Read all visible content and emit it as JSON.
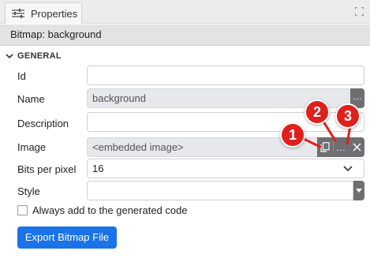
{
  "panel": {
    "tab_label": "Properties"
  },
  "header": {
    "title": "Bitmap: background"
  },
  "section": {
    "title": "GENERAL"
  },
  "fields": {
    "id": {
      "label": "Id",
      "value": ""
    },
    "name": {
      "label": "Name",
      "value": "background"
    },
    "description": {
      "label": "Description",
      "value": ""
    },
    "image": {
      "label": "Image",
      "value": "<embedded image>"
    },
    "bits_per_pixel": {
      "label": "Bits per pixel",
      "value": "16"
    },
    "style": {
      "label": "Style",
      "value": ""
    }
  },
  "checkbox": {
    "label": "Always add to the generated code",
    "checked": false
  },
  "button": {
    "label": "Export Bitmap File"
  },
  "badges": [
    "1",
    "2",
    "3"
  ],
  "colors": {
    "accent": "#1a73e8",
    "badge": "#e0201d",
    "action_bg": "#6d6f72"
  }
}
